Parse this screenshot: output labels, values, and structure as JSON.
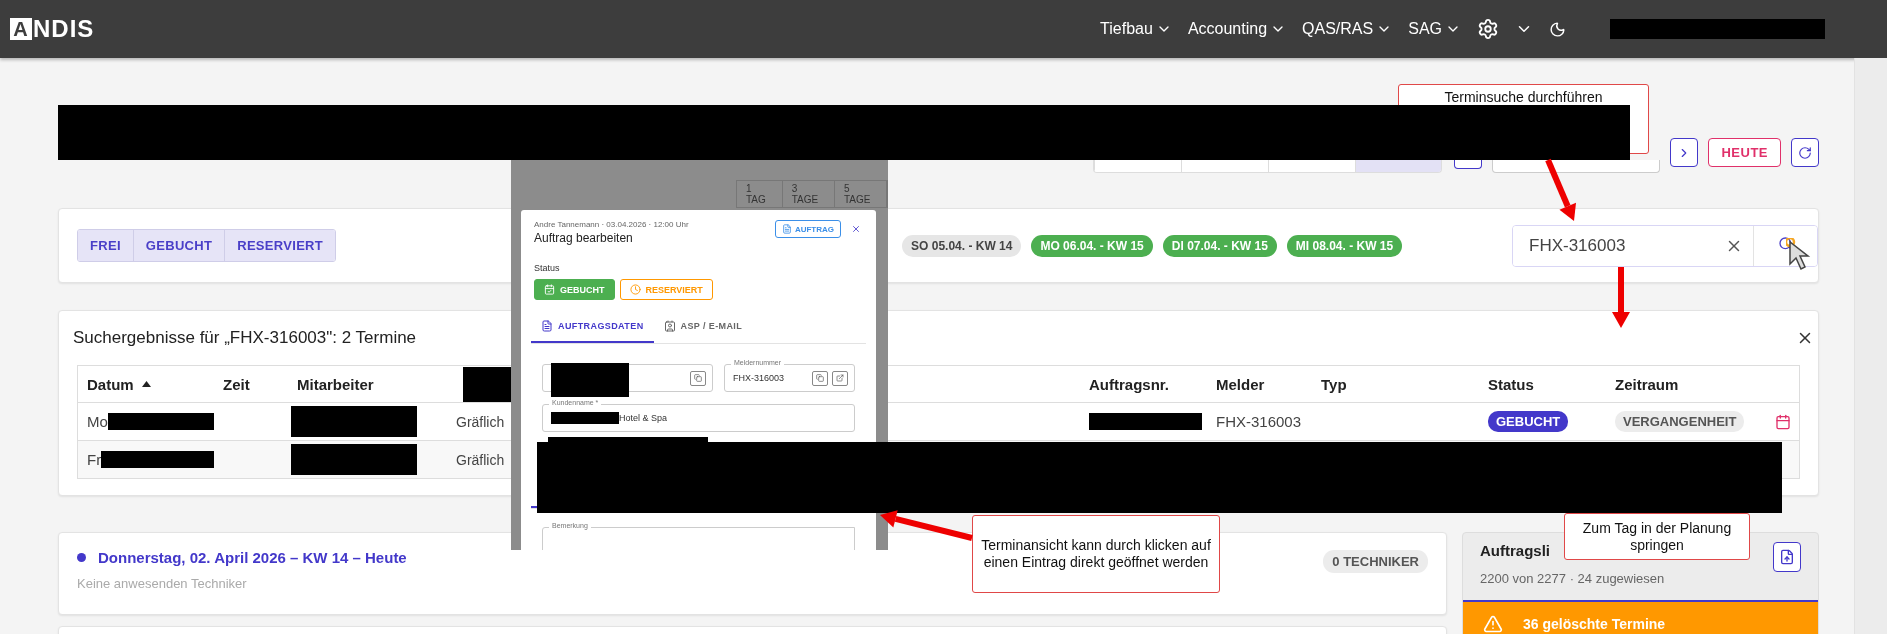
{
  "header": {
    "logo_mark": "A",
    "logo_text": "NDIS",
    "nav": [
      {
        "label": "Tiefbau"
      },
      {
        "label": "Accounting"
      },
      {
        "label": "QAS/RAS"
      },
      {
        "label": "SAG"
      }
    ]
  },
  "toolbar": {
    "view_segments": [
      {
        "selected": false
      },
      {
        "selected": false
      },
      {
        "selected": false
      },
      {
        "selected": true
      }
    ],
    "today_button": "HEUTE"
  },
  "filter": {
    "status_tabs": [
      {
        "label": "FREI"
      },
      {
        "label": "GEBUCHT"
      },
      {
        "label": "RESERVIERT"
      }
    ],
    "day_chips": [
      {
        "label": "SO 05.04. - KW 14",
        "kind": "weekend"
      },
      {
        "label": "MO 06.04. - KW 15",
        "kind": "workday"
      },
      {
        "label": "DI 07.04. - KW 15",
        "kind": "workday"
      },
      {
        "label": "MI 08.04. - KW 15",
        "kind": "workday"
      }
    ],
    "search": {
      "value": "FHX-316003"
    }
  },
  "results": {
    "title": "Suchergebnisse für „FHX-316003\": 2 Termine",
    "columns": [
      {
        "kind": "text",
        "label": "Datum",
        "sorted": true
      },
      {
        "kind": "text",
        "label": "Zeit"
      },
      {
        "kind": "text",
        "label": "Mitarbeiter"
      },
      {
        "kind": "redacted"
      },
      {
        "kind": "text",
        "label": "Auftragsnr."
      },
      {
        "kind": "text",
        "label": "Melder"
      },
      {
        "kind": "text",
        "label": "Typ"
      },
      {
        "kind": "text",
        "label": "Status"
      },
      {
        "kind": "text",
        "label": "Zeitraum"
      },
      {
        "kind": "empty"
      }
    ],
    "rows": [
      {
        "day": "Mo",
        "customer": "Gräflich",
        "melder": "FHX-316003",
        "status": "GEBUCHT",
        "period": "VERGANGENHEIT"
      },
      {
        "day": "Fr",
        "customer": "Gräflich"
      }
    ]
  },
  "day_card": {
    "title": "Donnerstag, 02. April 2026 – KW 14 – Heute",
    "subtitle": "Keine anwesenden Techniker",
    "count": "0 TECHNIKER"
  },
  "order_panel": {
    "title": "Auftragsli",
    "subtitle": "2200 von 2277 · 24 zugewiesen",
    "alert": "36 gelöschte Termine"
  },
  "modal": {
    "background_tabs": [
      "1 TAG",
      "3 TAGE",
      "5 TAGE"
    ],
    "meta": "Andre Tannemann · 03.04.2026 · 12:00 Uhr",
    "title": "Auftrag bearbeiten",
    "order_button": "AUFTRAG",
    "status_label": "Status",
    "status_buttons": [
      {
        "label": "GEBUCHT",
        "selected": true,
        "color": "#4caf50"
      },
      {
        "label": "RESERVIERT",
        "selected": false,
        "color": "#ff9800"
      }
    ],
    "tabs": [
      {
        "label": "AUFTRAGSDATEN",
        "selected": true
      },
      {
        "label": "ASP / E-MAIL",
        "selected": false
      }
    ],
    "reporter_field": {
      "label": "Meldernummer",
      "value": "FHX-316003"
    },
    "customer_field": {
      "label": "Kundenname *",
      "value": "Hotel & Spa"
    },
    "remark_label": "Bemerkung"
  },
  "annotations": [
    {
      "text": "Terminsuche durchführen"
    },
    {
      "text": "Terminansicht kann durch klicken auf einen Eintrag direkt geöffnet werden"
    },
    {
      "text": "Zum Tag in der Planung springen"
    }
  ]
}
